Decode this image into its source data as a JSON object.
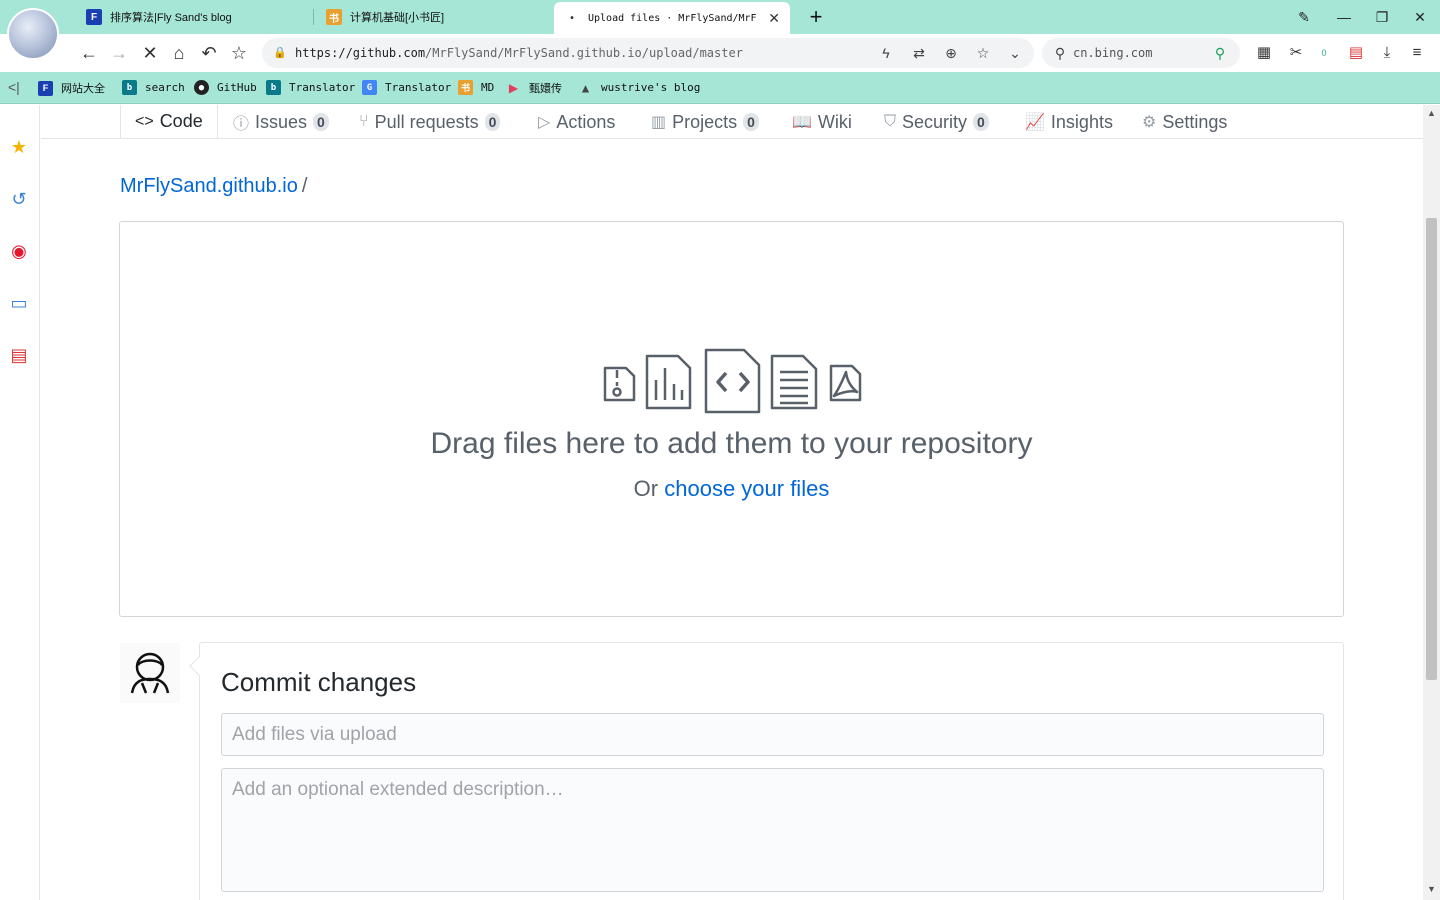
{
  "browser": {
    "tabs": [
      {
        "title": "排序算法|Fly Sand's blog",
        "favicon": "F"
      },
      {
        "title": "计算机基础[小书匠]",
        "favicon": "书"
      },
      {
        "title": "Upload files · MrFlySand/MrF",
        "favicon": "•"
      }
    ],
    "new_tab_symbol": "+",
    "url": {
      "scheme_host": "https://github.com",
      "path": "/MrFlySand/MrFlySand.github.io/upload/master"
    },
    "search_engine": "cn.bing.com",
    "bookmarks": [
      {
        "label": "网站大全",
        "favicon": "F",
        "color": "#1a3fb0"
      },
      {
        "label": "search",
        "favicon": "b",
        "color": "#0a7a8a"
      },
      {
        "label": "GitHub",
        "favicon": "●",
        "color": "#222222"
      },
      {
        "label": "Translator",
        "favicon": "b",
        "color": "#0a7a8a"
      },
      {
        "label": "Translator",
        "favicon": "G",
        "color": "#4285f4"
      },
      {
        "label": "MD",
        "favicon": "书",
        "color": "#e8a030"
      },
      {
        "label": "甄嬛传",
        "favicon": "▶",
        "color": "#e0405a"
      },
      {
        "label": "wustrive's blog",
        "favicon": "▲",
        "color": "#444444"
      }
    ],
    "colors": {
      "chrome": "#a6e6d6",
      "accent": "#0366d6"
    }
  },
  "repo_nav": {
    "tabs": [
      {
        "label": "Code",
        "icon": "code-icon",
        "glyph": "<>"
      },
      {
        "label": "Issues",
        "icon": "issue-icon",
        "glyph": "ⓘ",
        "count": "0"
      },
      {
        "label": "Pull requests",
        "icon": "pull-request-icon",
        "glyph": "⑂",
        "count": "0"
      },
      {
        "label": "Actions",
        "icon": "play-icon",
        "glyph": "▷"
      },
      {
        "label": "Projects",
        "icon": "project-icon",
        "glyph": "▥",
        "count": "0"
      },
      {
        "label": "Wiki",
        "icon": "book-icon",
        "glyph": "📖"
      },
      {
        "label": "Security",
        "icon": "shield-icon",
        "glyph": "⛉",
        "count": "0"
      },
      {
        "label": "Insights",
        "icon": "graph-icon",
        "glyph": "📈"
      },
      {
        "label": "Settings",
        "icon": "gear-icon",
        "glyph": "⚙"
      }
    ]
  },
  "breadcrumb": {
    "repo": "MrFlySand.github.io",
    "separator": "/"
  },
  "dropzone": {
    "title": "Drag files here to add them to your repository",
    "sub_prefix": "Or",
    "sub_link": "choose your files"
  },
  "commit": {
    "title": "Commit changes",
    "summary_placeholder": "Add files via upload",
    "description_placeholder": "Add an optional extended description…"
  }
}
